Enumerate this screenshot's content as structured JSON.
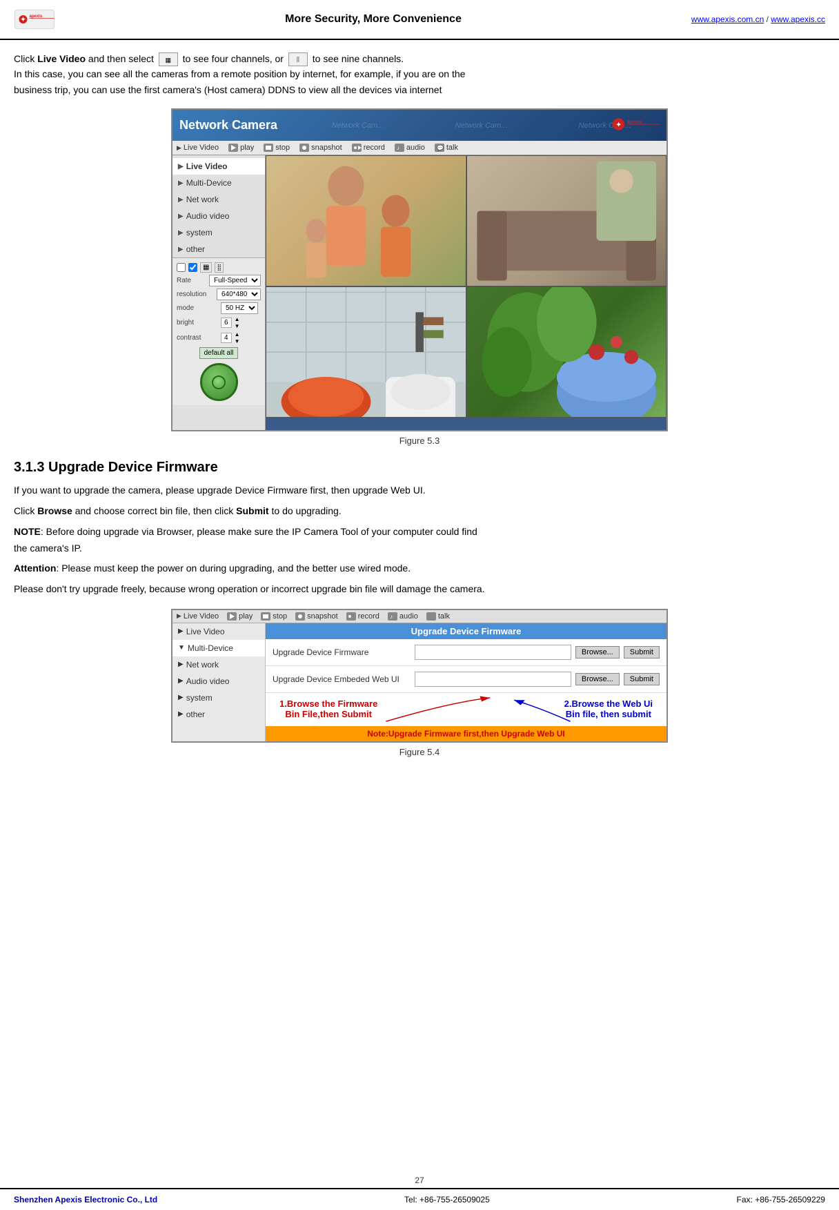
{
  "header": {
    "tagline": "More Security, More Convenience",
    "link1": "www.apexis.com.cn",
    "link2": "www.apexis.cc",
    "separator": " / "
  },
  "intro": {
    "part1": "Click ",
    "live_video_label": "Live Video",
    "part2": " and then select ",
    "part3": " to see four channels, or ",
    "part4": " to see nine channels.",
    "line2": "In this case, you can see all the cameras from a remote position by internet, for example, if you are on the",
    "line3": "business trip, you can use the first camera's (Host camera) DDNS to view all the devices via internet"
  },
  "figure3": {
    "caption": "Figure 5.3"
  },
  "camera_ui": {
    "header_title": "Network Camera",
    "watermarks": [
      "Network Cam...",
      "Network Cam...",
      "Network Cam...",
      "Network Cam..."
    ],
    "toolbar": {
      "items": [
        {
          "icon": "▶",
          "label": "Live Video"
        },
        {
          "icon": "▶",
          "label": "play"
        },
        {
          "icon": "■",
          "label": "stop"
        },
        {
          "icon": "📷",
          "label": "snapshot"
        },
        {
          "icon": "🎥",
          "label": "record"
        },
        {
          "icon": "🔊",
          "label": "audio"
        },
        {
          "icon": "💬",
          "label": "talk"
        }
      ]
    },
    "sidebar": {
      "items": [
        {
          "label": "Live Video",
          "active": true
        },
        {
          "label": "Multi-Device"
        },
        {
          "label": "Net work"
        },
        {
          "label": "Audio video"
        },
        {
          "label": "system"
        },
        {
          "label": "other"
        }
      ]
    },
    "controls": {
      "rows": [
        {
          "label": "Rate",
          "value": "Full-Speed"
        },
        {
          "label": "resolution",
          "value": "640*480"
        },
        {
          "label": "mode",
          "value": "50 HZ"
        },
        {
          "label": "bright",
          "value": "6"
        },
        {
          "label": "contrast",
          "value": "4"
        }
      ],
      "default_all": "default all"
    }
  },
  "section": {
    "heading": "3.1.3 Upgrade Device Firmware"
  },
  "upgrade_intro": {
    "line1": "If you want to upgrade the camera, please upgrade Device Firmware first, then upgrade Web UI.",
    "line2_pre": "Click ",
    "browse_label": "Browse",
    "line2_mid": " and choose correct bin file, then click ",
    "submit_label": "Submit",
    "line2_post": " to do upgrading.",
    "line3_pre": "NOTE",
    "line3_post": ": Before doing upgrade via Browser, please make sure the IP Camera Tool of your computer could find",
    "line4": "the camera's IP.",
    "line5_pre": "Attention",
    "line5_post": ": Please must keep the power on during upgrading, and the better use wired mode.",
    "line6": "Please don't try upgrade freely, because wrong operation or incorrect upgrade bin file will damage the camera."
  },
  "figure4": {
    "caption": "Figure 5.4"
  },
  "upgrade_ui": {
    "toolbar": {
      "items": [
        {
          "icon": "▶",
          "label": "Live Video"
        },
        {
          "icon": "▶",
          "label": "play"
        },
        {
          "icon": "■",
          "label": "stop"
        },
        {
          "icon": "📷",
          "label": "snapshot"
        },
        {
          "icon": "🎥",
          "label": "record"
        },
        {
          "icon": "🔊",
          "label": "audio"
        },
        {
          "icon": "💬",
          "label": "talk"
        }
      ]
    },
    "sidebar": {
      "items": [
        {
          "label": "Live Video"
        },
        {
          "label": "Multi-Device",
          "expanded": true
        },
        {
          "label": "Net work"
        },
        {
          "label": "Audio video"
        },
        {
          "label": "system"
        },
        {
          "label": "other"
        }
      ]
    },
    "main": {
      "title": "Upgrade Device Firmware",
      "rows": [
        {
          "label": "Upgrade Device Firmware",
          "browse_label": "Browse...",
          "submit_label": "Submit"
        },
        {
          "label": "Upgrade Device Embeded Web UI",
          "browse_label": "Browse...",
          "submit_label": "Submit"
        }
      ]
    },
    "annotations": {
      "left_line1": "1.Browse  the Firmware",
      "left_line2": "Bin File,then Submit",
      "right_line1": "2.Browse  the Web Ui",
      "right_line2": "Bin file, then submit",
      "note": "Note:Upgrade Firmware first,then Upgrade Web UI"
    }
  },
  "footer": {
    "page_number": "27",
    "company": "Shenzhen Apexis Electronic Co., Ltd",
    "tel_label": "Tel: +86-755-26509025",
    "fax_label": "Fax: +86-755-26509229"
  }
}
